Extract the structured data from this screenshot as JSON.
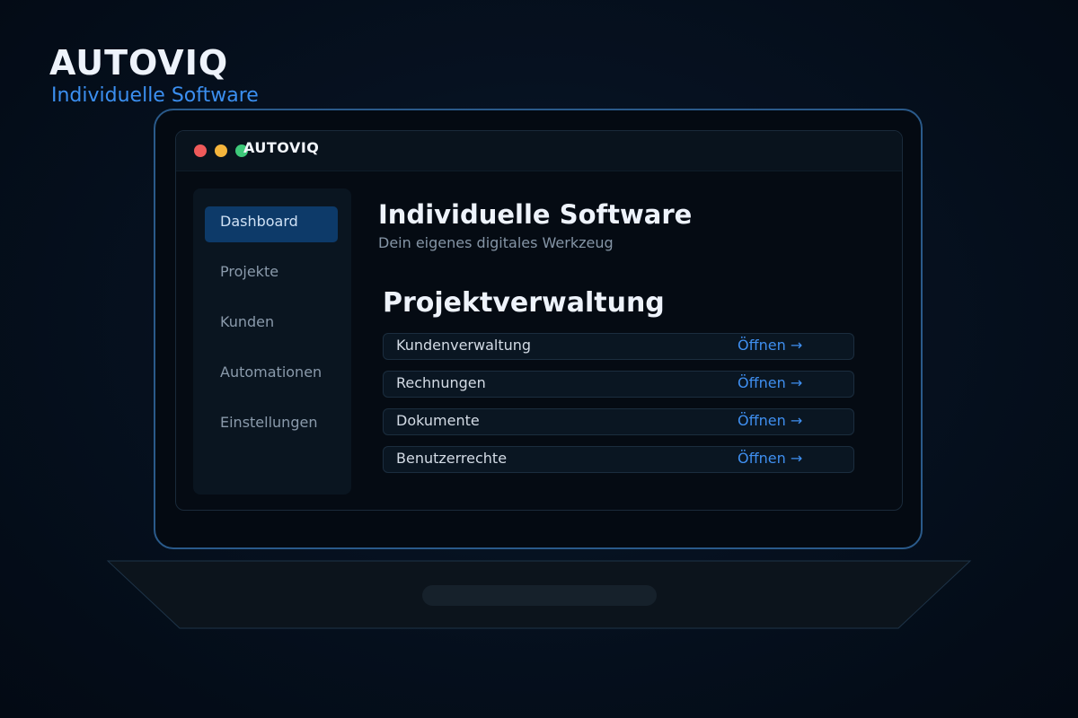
{
  "brand": {
    "title": "AUTOVIQ",
    "subtitle": "Individuelle Software"
  },
  "window": {
    "app_name": "AUTOVIQ",
    "controls": [
      "close-dot",
      "minimize-dot",
      "maximize-dot"
    ]
  },
  "sidebar": {
    "items": [
      {
        "label": "Dashboard",
        "active": true
      },
      {
        "label": "Projekte",
        "active": false
      },
      {
        "label": "Kunden",
        "active": false
      },
      {
        "label": "Automationen",
        "active": false
      },
      {
        "label": "Einstellungen",
        "active": false
      }
    ]
  },
  "main": {
    "title": "Individuelle Software",
    "subtitle": "Dein eigenes digitales Werkzeug",
    "section_title": "Projektverwaltung",
    "rows": [
      {
        "label": "Kundenverwaltung",
        "action": "Öffnen →"
      },
      {
        "label": "Rechnungen",
        "action": "Öffnen →"
      },
      {
        "label": "Dokumente",
        "action": "Öffnen →"
      },
      {
        "label": "Benutzerrechte",
        "action": "Öffnen →"
      }
    ]
  },
  "colors": {
    "accent": "#3b8ff0",
    "active_nav": "#0d3a69",
    "frame": "#2a5a8a",
    "close": "#ef5a5a",
    "minimize": "#f5b53c",
    "maximize": "#3ec97a"
  }
}
